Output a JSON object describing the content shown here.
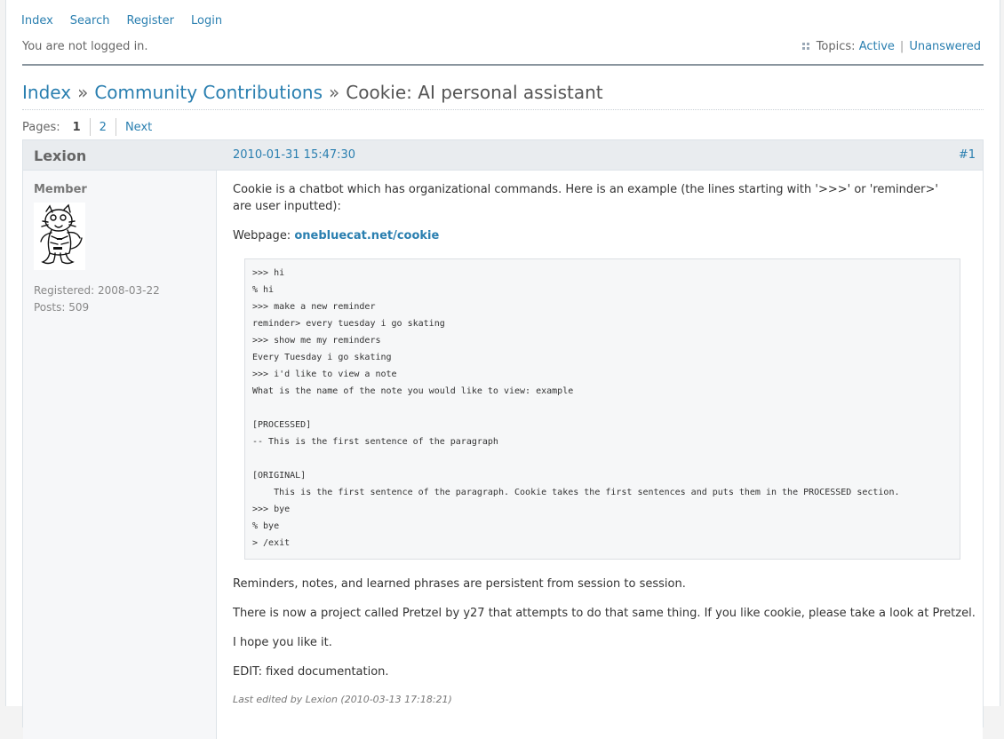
{
  "nav": {
    "index": "Index",
    "search": "Search",
    "register": "Register",
    "login": "Login"
  },
  "status": {
    "login_state": "You are not logged in.",
    "topics_label": "Topics:",
    "active": "Active",
    "separator": "|",
    "unanswered": "Unanswered"
  },
  "breadcrumb": {
    "index": "Index",
    "sep": "»",
    "forum": "Community Contributions",
    "topic": "Cookie: AI personal assistant"
  },
  "pagination": {
    "label": "Pages:",
    "current": "1",
    "page2": "2",
    "next": "Next"
  },
  "post": {
    "author": "Lexion",
    "date": "2010-01-31 15:47:30",
    "number": "#1",
    "role": "Member",
    "registered": "Registered: 2008-03-22",
    "posts": "Posts: 509",
    "intro": "Cookie is a chatbot which has organizational commands. Here is an example (the lines starting with '>>>' or 'reminder>' are user inputted):",
    "webpage_label": "Webpage:",
    "webpage_link": "onebluecat.net/cookie",
    "code_lines": [
      ">>> hi",
      "% hi",
      ">>> make a new reminder",
      "reminder> every tuesday i go skating",
      ">>> show me my reminders",
      "Every Tuesday i go skating",
      ">>> i'd like to view a note",
      "What is the name of the note you would like to view: example",
      "",
      "[PROCESSED]",
      "-- This is the first sentence of the paragraph",
      "",
      "[ORIGINAL]",
      "    This is the first sentence of the paragraph. Cookie takes the first sentences and puts them in the PROCESSED section.",
      ">>> bye",
      "% bye",
      "> /exit"
    ],
    "para_persistent": "Reminders, notes, and learned phrases are persistent from session to session.",
    "para_pretzel": "There is now a project called Pretzel by y27 that attempts to do that same thing. If you like cookie, please take a look at Pretzel.",
    "para_hope": "I hope you like it.",
    "para_edit": "EDIT: fixed documentation.",
    "edited_note": "Last edited by Lexion (2010-03-13 17:18:21)"
  }
}
